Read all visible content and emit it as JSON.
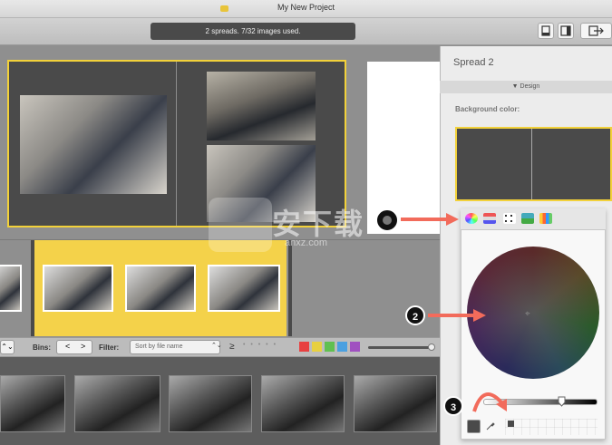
{
  "window": {
    "title": "My New Project"
  },
  "toolbar": {
    "status": "2 spreads. 7/32 images used."
  },
  "binsbar": {
    "bins_label": "Bins:",
    "prev": "<",
    "next": ">",
    "filter_label": "Filter:",
    "sort_value": "Sort by file name",
    "sort_arrows": "⌃⌄",
    "stepper": "⌃⌄",
    "gte": "≥",
    "dots": "• • • • •",
    "swatches": [
      "#e84040",
      "#e8d040",
      "#60c050",
      "#4aa0e0",
      "#a050c0"
    ]
  },
  "panel": {
    "title": "Spread 2",
    "design_label": "▼ Design",
    "bg_label": "Background color:"
  },
  "picker": {
    "tabs": [
      "color-wheel",
      "color-sliders",
      "color-palettes",
      "image-palettes",
      "crayons"
    ],
    "current_color": "#4a4a4a"
  },
  "annotations": {
    "badge2": "2",
    "badge3": "3"
  },
  "watermark": {
    "text": "安下载",
    "sub": "anxz.com"
  }
}
